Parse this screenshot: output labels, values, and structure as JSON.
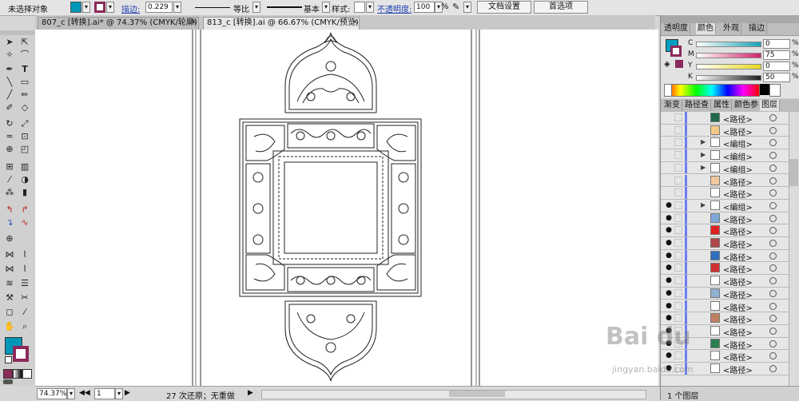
{
  "control": {
    "selection": "未选择对象",
    "stroke_label": "描边:",
    "stroke_value": "0.229",
    "uniform": "等比",
    "basic": "基本",
    "style_label": "样式:",
    "opacity_label": "不透明度:",
    "opacity_value": "100",
    "percent": "%",
    "doc_setup": "文档设置",
    "prefs": "首选项"
  },
  "tabs": [
    {
      "label": "807_c [转换].ai* @ 74.37% (CMYK/轮廓)",
      "close": "×"
    },
    {
      "label": "813_c [转换].ai @ 66.67% (CMYK/预览)",
      "close": "×"
    }
  ],
  "status": {
    "zoom": "74.37%",
    "page": "1",
    "history": "27 次还原；无重做"
  },
  "panels": {
    "top_tabs": [
      "透明度",
      "颜色",
      "外观",
      "描边"
    ],
    "channels": [
      {
        "label": "C",
        "value": "0",
        "color": "#1aa3b8"
      },
      {
        "label": "M",
        "value": "75",
        "color": "#d0246a"
      },
      {
        "label": "Y",
        "value": "0",
        "color": "#e8d81c"
      },
      {
        "label": "K",
        "value": "50",
        "color": "#222222"
      }
    ],
    "fill_color": "#009fc0",
    "stroke_color": "#8b2a5a",
    "bottom_tabs": [
      "渐变",
      "路径查",
      "属性",
      "颜色参",
      "图层"
    ],
    "layer_count": "1 个图层"
  },
  "layers": [
    {
      "name": "<路径>",
      "visible": false,
      "thumb": "#1f6b4a",
      "group": false
    },
    {
      "name": "<路径>",
      "visible": false,
      "thumb": "#f5c88a",
      "group": false
    },
    {
      "name": "<编组>",
      "visible": false,
      "thumb": "#ffffff",
      "group": true
    },
    {
      "name": "<编组>",
      "visible": false,
      "thumb": "#ffffff",
      "group": true
    },
    {
      "name": "<编组>",
      "visible": false,
      "thumb": "#ffffff",
      "group": true
    },
    {
      "name": "<路径>",
      "visible": false,
      "thumb": "#f0c8a0",
      "group": false
    },
    {
      "name": "<路径>",
      "visible": false,
      "thumb": "#ffffff",
      "group": false
    },
    {
      "name": "<编组>",
      "visible": true,
      "thumb": "#ffffff",
      "group": true
    },
    {
      "name": "<路径>",
      "visible": true,
      "thumb": "#7fa8d8",
      "group": false
    },
    {
      "name": "<路径>",
      "visible": true,
      "thumb": "#e02020",
      "group": false
    },
    {
      "name": "<路径>",
      "visible": true,
      "thumb": "#b04848",
      "group": false
    },
    {
      "name": "<路径>",
      "visible": true,
      "thumb": "#3070c0",
      "group": false
    },
    {
      "name": "<路径>",
      "visible": true,
      "thumb": "#d03030",
      "group": false
    },
    {
      "name": "<路径>",
      "visible": true,
      "thumb": "#ffffff",
      "group": false
    },
    {
      "name": "<路径>",
      "visible": true,
      "thumb": "#90b0d0",
      "group": false
    },
    {
      "name": "<路径>",
      "visible": true,
      "thumb": "#ffffff",
      "group": false
    },
    {
      "name": "<路径>",
      "visible": true,
      "thumb": "#c08060",
      "group": false
    },
    {
      "name": "<路径>",
      "visible": true,
      "thumb": "#ffffff",
      "group": false
    },
    {
      "name": "<路径>",
      "visible": true,
      "thumb": "#2a8050",
      "group": false
    },
    {
      "name": "<路径>",
      "visible": true,
      "thumb": "#ffffff",
      "group": false
    },
    {
      "name": "<路径>",
      "visible": true,
      "thumb": "#ffffff",
      "group": false
    }
  ],
  "watermark": {
    "brand": "Bai du",
    "sub": "jingyan.baidu.com"
  }
}
